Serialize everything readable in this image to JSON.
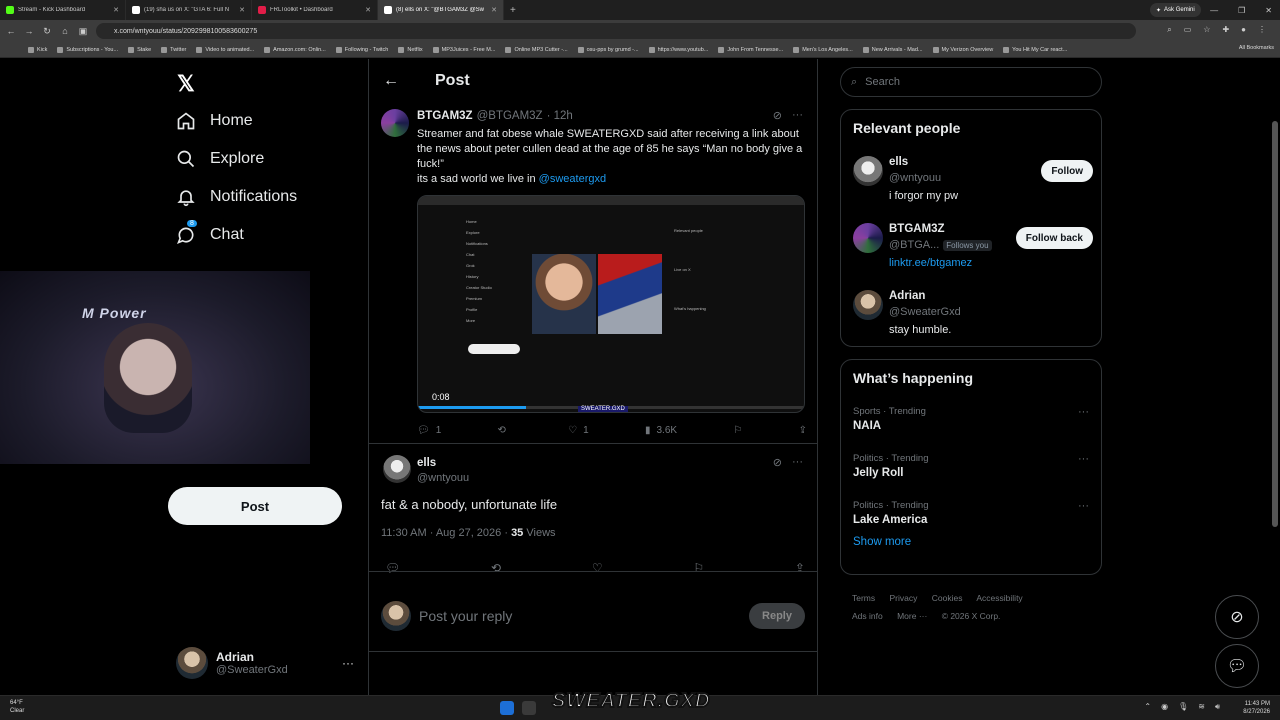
{
  "browser": {
    "tabs": [
      {
        "label": "Stream - Kick Dashboard",
        "color": "#53fc18",
        "active": false
      },
      {
        "label": "(19) sha us on X: \"GTA 6: Full N",
        "color": "#ffffff",
        "active": false
      },
      {
        "label": "FRLToolkit • Dashboard",
        "color": "#e11d48",
        "active": false
      },
      {
        "label": "(8) ells on X: \"@BTGAM3Z @Sw",
        "color": "#ffffff",
        "active": true
      }
    ],
    "ask_gemini": "Ask Gemini",
    "url": "x.com/wntyouu/status/2092998100583600275",
    "bookmarks": [
      "Kick",
      "Subscriptions - You...",
      "Stake",
      "Twitter",
      "Video to animated...",
      "Amazon.com: Onlin...",
      "Following - Twitch",
      "Netflix",
      "MP3Juices - Free M...",
      "Online MP3 Cutter -...",
      "osu-pps by grumd -...",
      "https://www.youtub...",
      "John From Tennesse...",
      "Men's Los Angeles...",
      "New Arrivals - Mad...",
      "My Verizon Overview",
      "You Hit My Car react..."
    ],
    "all_bookmarks": "All Bookmarks"
  },
  "nav": {
    "logo": "𝕏",
    "items": [
      {
        "label": "Home",
        "icon": "home-icon",
        "glyph": "⌂"
      },
      {
        "label": "Explore",
        "icon": "search-icon",
        "glyph": "⌕"
      },
      {
        "label": "Notifications",
        "icon": "bell-icon",
        "glyph": "🔔"
      },
      {
        "label": "Chat",
        "icon": "chat-icon",
        "glyph": "💬",
        "badge": "8"
      }
    ],
    "post_button": "Post",
    "account": {
      "name": "Adrian",
      "handle": "@SweaterGxd",
      "more": "···"
    }
  },
  "header": {
    "title": "Post",
    "back": "←"
  },
  "tweet": {
    "name": "BTGAM3Z",
    "handle": "@BTGAM3Z",
    "time": "· 12h",
    "text": "Streamer and fat obese whale SWEATERGXD said after receiving a link about the news about peter cullen dead at the age of 85 he says “Man no body give a fuck!”\nits a sad world we live in ",
    "mention": "@sweatergxd",
    "media": {
      "timer": "0:08",
      "caption": "SWEATER.GXD",
      "progress": 0.28,
      "inner_nav": [
        "Home",
        "Explore",
        "Notifications",
        "Chat",
        "Grok",
        "History",
        "Creator Studio",
        "Premium",
        "Profile",
        "More"
      ],
      "inner_right": [
        "Relevant people",
        "Live on X",
        "What's happening"
      ]
    },
    "actions": {
      "replies": "1",
      "reposts": "",
      "likes": "1",
      "views": "3.6K"
    }
  },
  "reply_tweet": {
    "name": "ells",
    "handle": "@wntyouu",
    "text": "fat & a nobody, unfortunate life",
    "meta": "11:30 AM · Aug 27, 2026 · ",
    "views_count": "35",
    "views_label": " Views"
  },
  "reply_box": {
    "placeholder": "Post your reply",
    "button": "Reply"
  },
  "search": {
    "placeholder": "Search"
  },
  "relevant": {
    "title": "Relevant people",
    "people": [
      {
        "name": "ells",
        "handle": "@wntyouu",
        "bio": "i forgor my pw",
        "button": "Follow",
        "follows_you": ""
      },
      {
        "name": "BTGAM3Z",
        "handle": "@BTGA...",
        "bio": "linktr.ee/btgamez",
        "button": "Follow back",
        "follows_you": "Follows you"
      },
      {
        "name": "Adrian",
        "handle": "@SweaterGxd",
        "bio": "stay humble.",
        "button": "",
        "follows_you": ""
      }
    ]
  },
  "happening": {
    "title": "What’s happening",
    "trends": [
      {
        "category": "Sports · Trending",
        "name": "NAIA"
      },
      {
        "category": "Politics · Trending",
        "name": "Jelly Roll"
      },
      {
        "category": "Politics · Trending",
        "name": "Lake America"
      }
    ],
    "show_more": "Show more"
  },
  "footer": {
    "links": [
      "Terms",
      "Privacy",
      "Cookies",
      "Accessibility",
      "Ads info",
      "More ···"
    ],
    "copyright": "© 2026 X Corp."
  },
  "webcam": {
    "banner": "M Power"
  },
  "taskbar": {
    "weather_temp": "64°F",
    "weather_desc": "Clear",
    "overlay": "SWEATER.GXD",
    "time": "11:43 PM",
    "date": "8/27/2026"
  }
}
